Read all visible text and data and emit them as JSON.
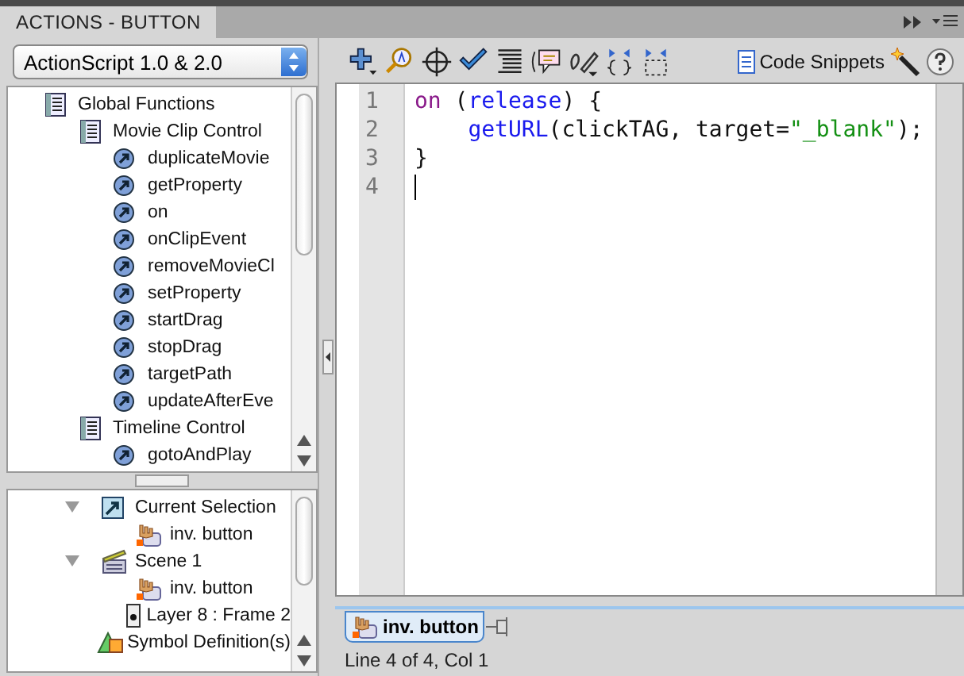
{
  "panel": {
    "title": "ACTIONS - BUTTON"
  },
  "language": {
    "value": "ActionScript 1.0 & 2.0"
  },
  "toolbox": [
    {
      "label": "Global Functions",
      "kind": "category",
      "children": [
        {
          "label": "Movie Clip Control",
          "kind": "category",
          "children": [
            {
              "label": "duplicateMovie",
              "kind": "function"
            },
            {
              "label": "getProperty",
              "kind": "function"
            },
            {
              "label": "on",
              "kind": "function"
            },
            {
              "label": "onClipEvent",
              "kind": "function"
            },
            {
              "label": "removeMovieCl",
              "kind": "function"
            },
            {
              "label": "setProperty",
              "kind": "function"
            },
            {
              "label": "startDrag",
              "kind": "function"
            },
            {
              "label": "stopDrag",
              "kind": "function"
            },
            {
              "label": "targetPath",
              "kind": "function"
            },
            {
              "label": "updateAfterEve",
              "kind": "function"
            }
          ]
        },
        {
          "label": "Timeline Control",
          "kind": "category",
          "children": [
            {
              "label": "gotoAndPlay",
              "kind": "function"
            }
          ]
        }
      ]
    }
  ],
  "navigator": [
    {
      "label": "Current Selection",
      "kind": "selection",
      "expanded": true,
      "children": [
        {
          "label": "inv. button",
          "kind": "button"
        }
      ]
    },
    {
      "label": "Scene 1",
      "kind": "scene",
      "expanded": true,
      "children": [
        {
          "label": "inv. button",
          "kind": "button"
        },
        {
          "label": "Layer 8 : Frame 2",
          "kind": "layer"
        }
      ]
    },
    {
      "label": "Symbol Definition(s)",
      "kind": "symbols"
    }
  ],
  "toolbar": {
    "code_snippets": "Code Snippets"
  },
  "code": [
    {
      "number": "1",
      "tokens": [
        {
          "text": "on",
          "kind": "keyword"
        },
        {
          "text": " (",
          "kind": "plain"
        },
        {
          "text": "release",
          "kind": "identifier"
        },
        {
          "text": ") {",
          "kind": "plain"
        }
      ]
    },
    {
      "number": "2",
      "indent": true,
      "tokens": [
        {
          "text": "getURL",
          "kind": "identifier"
        },
        {
          "text": "(clickTAG, target=",
          "kind": "plain"
        },
        {
          "text": "\"_blank\"",
          "kind": "string"
        },
        {
          "text": ");",
          "kind": "plain"
        }
      ]
    },
    {
      "number": "3",
      "tokens": [
        {
          "text": "}",
          "kind": "plain"
        }
      ]
    },
    {
      "number": "4"
    }
  ],
  "script_tabs": [
    {
      "label": "inv. button",
      "selected": true
    }
  ],
  "status_bar": "Line 4 of 4, Col 1"
}
